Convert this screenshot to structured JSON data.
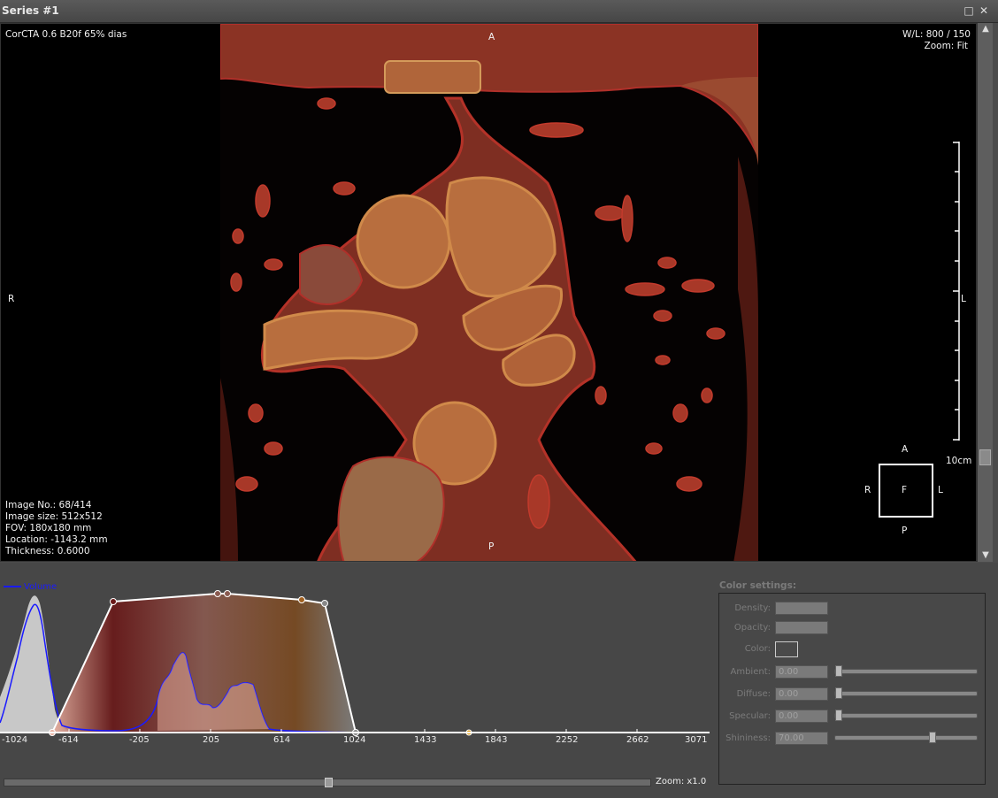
{
  "window": {
    "title": "Series #1"
  },
  "titlebar_buttons": {
    "maximize": "□",
    "close": "✕"
  },
  "overlay": {
    "top_left": "CorCTA  0.6  B20f  65% dias",
    "top_right_1": "W/L: 800 / 150",
    "top_right_2": "Zoom: Fit",
    "top_center": "A",
    "bottom_center": "P",
    "left_center": "R",
    "ruler_label": "L",
    "scale_label": "10cm",
    "bottom_left": [
      "Image No.: 68/414",
      "Image size: 512x512",
      "FOV: 180x180 mm",
      "Location: -1143.2 mm",
      "Thickness: 0.6000"
    ]
  },
  "orientation_cube": {
    "top": "A",
    "bottom": "P",
    "left": "R",
    "right": "L",
    "center": "F"
  },
  "histogram": {
    "legend": "Volume",
    "x_ticks": [
      "-1024",
      "-614",
      "-205",
      "205",
      "614",
      "1024",
      "1433",
      "1843",
      "2252",
      "2662",
      "3071"
    ],
    "zoom_label": "Zoom: x1.0"
  },
  "color_settings": {
    "title": "Color settings:",
    "density_label": "Density:",
    "opacity_label": "Opacity:",
    "color_label": "Color:",
    "ambient_label": "Ambient:",
    "ambient_value": "0.00",
    "ambient_level": 0.0,
    "diffuse_label": "Diffuse:",
    "diffuse_value": "0.00",
    "diffuse_level": 0.0,
    "specular_label": "Specular:",
    "specular_value": "0.00",
    "specular_level": 0.0,
    "shininess_label": "Shininess:",
    "shininess_value": "70.00",
    "shininess_level": 0.7
  },
  "colors": {
    "volume_line": "#1a1aff",
    "tissue_red": "#8a2a20",
    "tissue_orange": "#c88a4a"
  }
}
